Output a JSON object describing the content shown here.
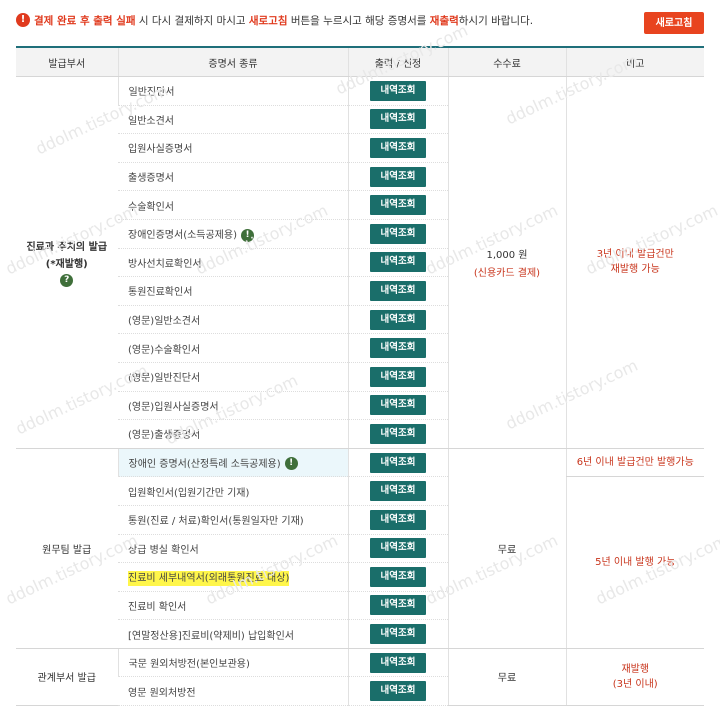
{
  "notice": {
    "icon": "!",
    "part1": "결제 완료 후 출력 실패",
    "part2": " 시 다시 결제하지 마시고 ",
    "part3": "새로고침",
    "part4": " 버튼을 누르시고 해당 증명서를 ",
    "part5": "재출력",
    "part6": "하시기 바랍니다."
  },
  "refresh_button": "새로고침",
  "headers": [
    "발급부서",
    "증명서 종류",
    "출력 / 신청",
    "수수료",
    "비고"
  ],
  "action_label": "내역조회",
  "sections": [
    {
      "dept": "진료과 주치의 발급",
      "dept_sub": "(*재발행)",
      "fee": "1,000 원",
      "fee_sub": "(신용카드 결제)",
      "note": "3년 이내 발급건만\n재발행 가능",
      "items": [
        "일반진단서",
        "일반소견서",
        "입원사실증명서",
        "출생증명서",
        "수술확인서",
        "장애인증명서(소득공제용)",
        "방사선치료확인서",
        "통원진료확인서",
        "(영문)일반소견서",
        "(영문)수술확인서",
        "(영문)일반진단서",
        "(영문)입원사실증명서",
        "(영문)출생증명서"
      ]
    },
    {
      "dept": "원무팀 발급",
      "fee": "무료",
      "note_top": "6년 이내 발급건만 발행가능",
      "note": "5년 이내 발행 가능",
      "items": [
        "장애인 증명서(산정특례 소득공제용)",
        "입원확인서(입원기간만 기재)",
        "통원(진료 / 처료)확인서(통원일자만 기재)",
        "상급 병실 확인서",
        "진료비 세부내역서(외래통원진료 대상)",
        "진료비 확인서",
        "[연말정산용]진료비(약제비) 납입확인서"
      ]
    },
    {
      "dept": "관계부서 발급",
      "fee": "무료",
      "note": "재발행\n(3년 이내)",
      "items": [
        "국문 원외처방전(본인보관용)",
        "영문 원외처방전"
      ]
    }
  ],
  "watermark": "ddolm.tistory.com"
}
